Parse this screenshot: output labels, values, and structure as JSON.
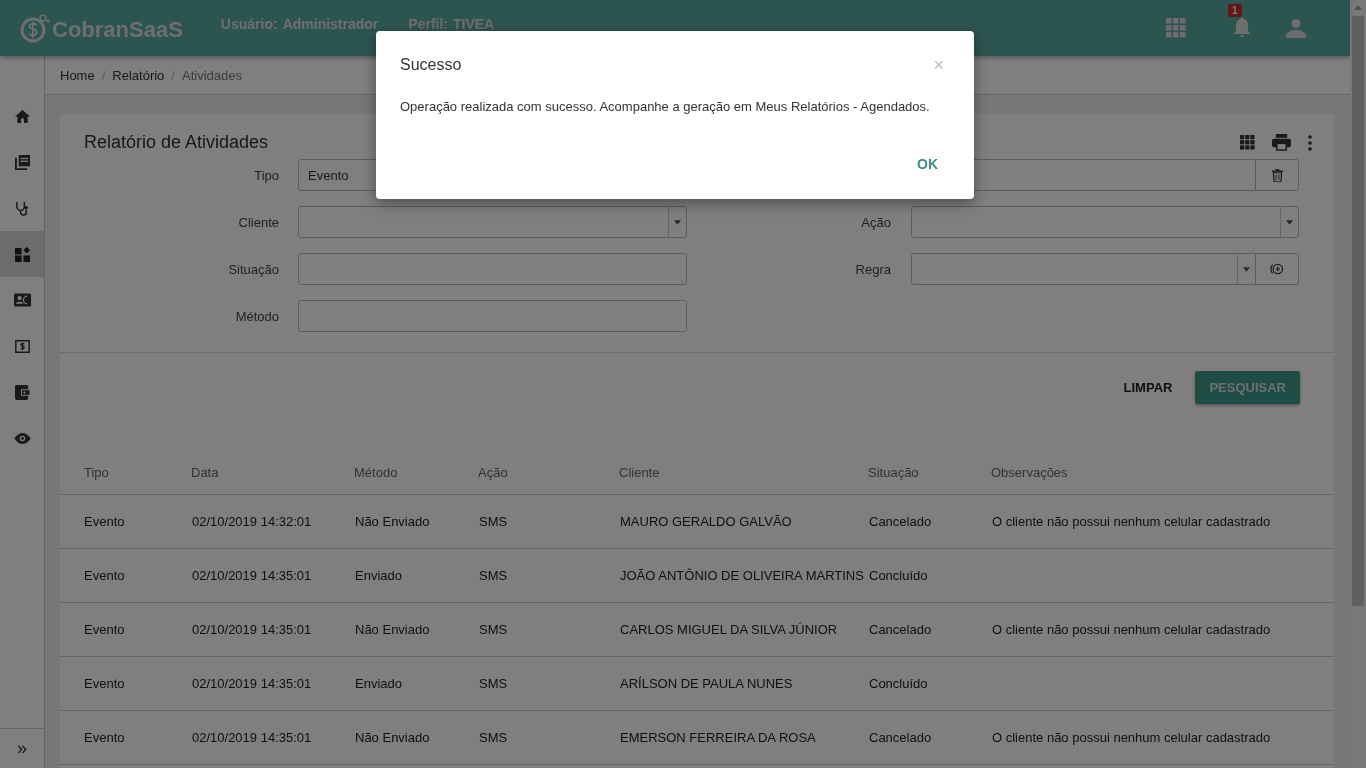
{
  "header": {
    "logo": "CobranSaaS",
    "user_label": "Usuário:",
    "user": "Administrador",
    "profile_label": "Perfil:",
    "profile": "TIVEA",
    "notifications_badge": "1"
  },
  "sidebar": {
    "items": [
      {
        "kind": "home",
        "selected": false
      },
      {
        "kind": "book",
        "selected": false
      },
      {
        "kind": "stethoscope",
        "selected": false
      },
      {
        "kind": "widgets",
        "selected": true
      },
      {
        "kind": "contact",
        "selected": false
      },
      {
        "kind": "money",
        "selected": false
      },
      {
        "kind": "wallet",
        "selected": false
      },
      {
        "kind": "eye",
        "selected": false
      }
    ],
    "expand": "»"
  },
  "breadcrumb": {
    "separator": "/",
    "items": [
      {
        "label": "Home",
        "current": false
      },
      {
        "label": "Relatório",
        "current": false
      },
      {
        "label": "Atividades",
        "current": true
      }
    ]
  },
  "card": {
    "title": "Relatório de Atividades"
  },
  "form": {
    "left": [
      {
        "label": "Tipo",
        "value": "Evento",
        "kind": "text"
      },
      {
        "label": "Cliente",
        "kind": "select"
      },
      {
        "label": "Situação",
        "kind": "text"
      },
      {
        "label": "Método",
        "kind": "text"
      }
    ],
    "right": [
      {
        "kind": "text",
        "addon": {
          "kind": "trash"
        }
      },
      {
        "label": "Ação",
        "kind": "select"
      },
      {
        "label": "Regra",
        "kind": "select",
        "addon": {
          "kind": "target"
        }
      }
    ]
  },
  "buttons": {
    "clear": "LIMPAR",
    "search": "PESQUISAR"
  },
  "table": {
    "columns": [
      "Tipo",
      "Data",
      "Método",
      "Ação",
      "Cliente",
      "Situação",
      "Observações"
    ],
    "rows": [
      [
        "Evento",
        "02/10/2019 14:32:01",
        "Não Enviado",
        "SMS",
        "MAURO GERALDO GALVÃO",
        "Cancelado",
        "O cliente não possui nenhum celular cadastrado"
      ],
      [
        "Evento",
        "02/10/2019 14:35:01",
        "Enviado",
        "SMS",
        "JOÃO ANTÔNIO DE OLIVEIRA MARTINS",
        "Concluído",
        ""
      ],
      [
        "Evento",
        "02/10/2019 14:35:01",
        "Não Enviado",
        "SMS",
        "CARLOS MIGUEL DA SILVA JÚNIOR",
        "Cancelado",
        "O cliente não possui nenhum celular cadastrado"
      ],
      [
        "Evento",
        "02/10/2019 14:35:01",
        "Enviado",
        "SMS",
        "ARÍLSON DE PAULA NUNES",
        "Concluído",
        ""
      ],
      [
        "Evento",
        "02/10/2019 14:35:01",
        "Não Enviado",
        "SMS",
        "EMERSON FERREIRA DA ROSA",
        "Cancelado",
        "O cliente não possui nenhum celular cadastrado"
      ]
    ]
  },
  "modal": {
    "title": "Sucesso",
    "close": "×",
    "message": "Operação realizada com sucesso. Acompanhe a geração em Meus Relatórios - Agendados.",
    "ok": "OK"
  }
}
